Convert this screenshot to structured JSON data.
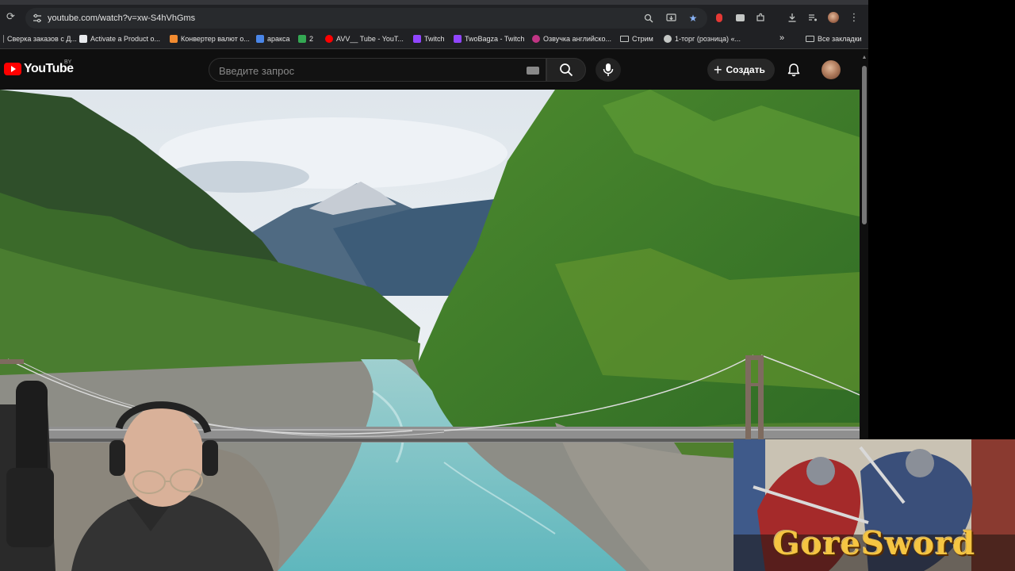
{
  "browser": {
    "url": "youtube.com/watch?v=xw-S4hVhGms",
    "bookmarks": [
      {
        "label": "Сверка заказов с Д...",
        "color": "#8a8a8a"
      },
      {
        "label": "Activate a Product o...",
        "color": "#e8eaed"
      },
      {
        "label": "Конвертер валют о...",
        "color": "#f28b30"
      },
      {
        "label": "аракса",
        "color": "#4a86e8"
      },
      {
        "label": "2",
        "color": "#34a853"
      },
      {
        "label": "AVV__ Tube - YouT...",
        "color": "#ff0000"
      },
      {
        "label": "Twitch",
        "color": "#9146ff"
      },
      {
        "label": "TwoBagza - Twitch",
        "color": "#9146ff"
      },
      {
        "label": "Озвучка английско...",
        "color": "#c13584"
      },
      {
        "label": "Стрим",
        "color": "#c4c7c5"
      },
      {
        "label": "1-торг (розница) «...",
        "color": "#c4c7c5"
      }
    ],
    "overflow_label": "»",
    "all_bookmarks_label": "Все закладки"
  },
  "youtube": {
    "logo_text": "YouTube",
    "country_code": "BY",
    "search_placeholder": "Введите запрос",
    "create_label": "Создать"
  },
  "overlay": {
    "game_title": "GoreSword"
  },
  "colors": {
    "brand_red": "#ff0000",
    "game_gold": "#f5c542"
  }
}
